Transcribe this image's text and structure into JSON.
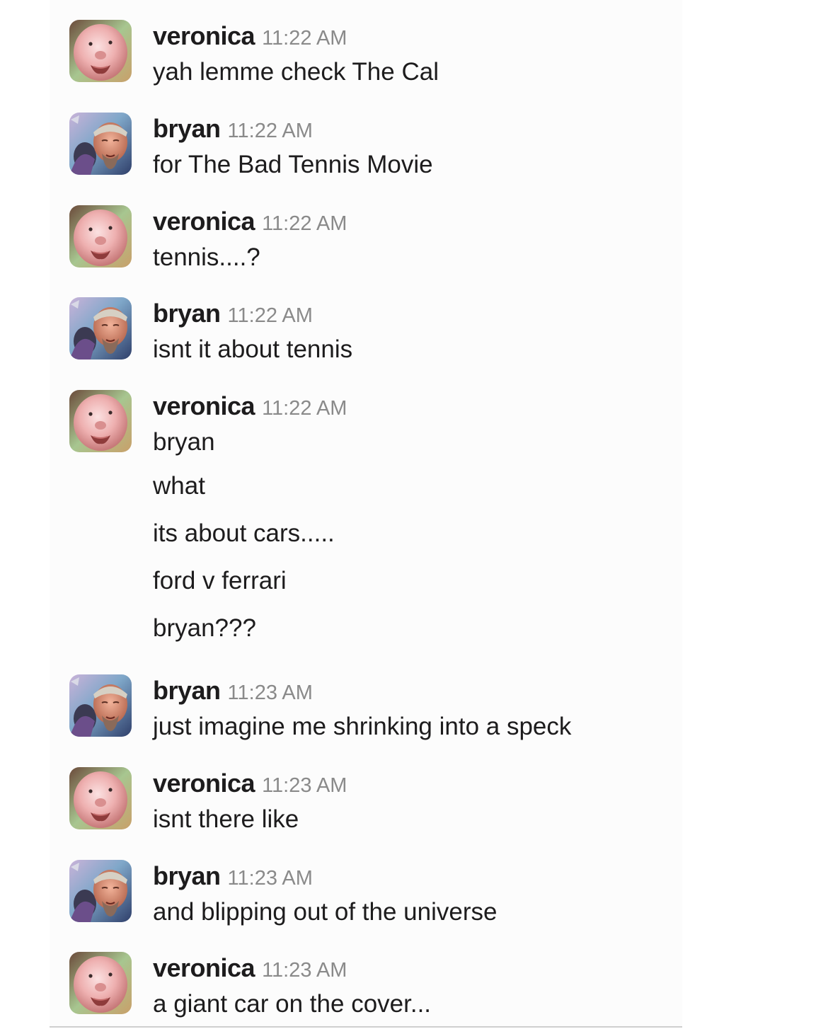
{
  "messages": [
    {
      "user": "veronica",
      "time": "11:22 AM",
      "avatar": "veronica-avatar",
      "lines": [
        "yah lemme check The Cal"
      ]
    },
    {
      "user": "bryan",
      "time": "11:22 AM",
      "avatar": "bryan-avatar",
      "lines": [
        "for The Bad Tennis Movie"
      ]
    },
    {
      "user": "veronica",
      "time": "11:22 AM",
      "avatar": "veronica-avatar",
      "lines": [
        "tennis....?"
      ]
    },
    {
      "user": "bryan",
      "time": "11:22 AM",
      "avatar": "bryan-avatar",
      "lines": [
        "isnt it about tennis"
      ]
    },
    {
      "user": "veronica",
      "time": "11:22 AM",
      "avatar": "veronica-avatar",
      "lines": [
        "bryan",
        "what",
        "its about cars.....",
        "ford v ferrari",
        "bryan???"
      ]
    },
    {
      "user": "bryan",
      "time": "11:23 AM",
      "avatar": "bryan-avatar",
      "lines": [
        "just imagine me shrinking into a speck"
      ]
    },
    {
      "user": "veronica",
      "time": "11:23 AM",
      "avatar": "veronica-avatar",
      "lines": [
        "isnt there like"
      ]
    },
    {
      "user": "bryan",
      "time": "11:23 AM",
      "avatar": "bryan-avatar",
      "lines": [
        "and blipping out of the universe"
      ]
    },
    {
      "user": "veronica",
      "time": "11:23 AM",
      "avatar": "veronica-avatar",
      "lines": [
        "a giant car on the cover..."
      ]
    }
  ],
  "colors": {
    "name": "#1d1c1d",
    "timestamp": "#8a8a8a",
    "text": "#1d1c1d"
  }
}
